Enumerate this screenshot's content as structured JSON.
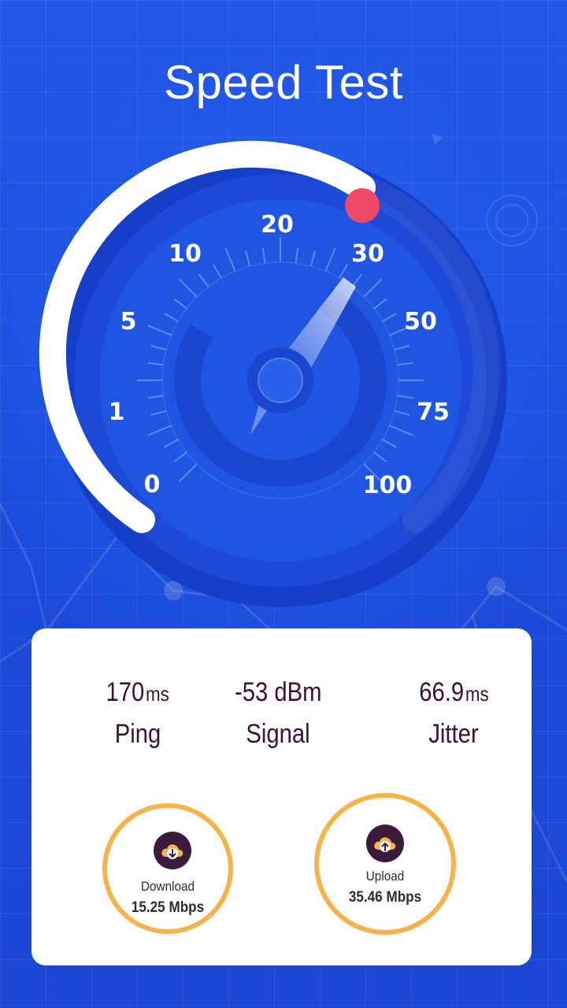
{
  "header": {
    "title": "Speed Test"
  },
  "gauge": {
    "scale_labels": [
      "0",
      "1",
      "5",
      "10",
      "20",
      "30",
      "50",
      "75",
      "100"
    ],
    "current_scale_position": "30"
  },
  "stats": {
    "ping": {
      "value": "170",
      "unit": "ms",
      "label": "Ping"
    },
    "signal": {
      "value": "-53 dBm",
      "label": "Signal"
    },
    "jitter": {
      "value": "66.9",
      "unit": "ms",
      "label": "Jitter"
    }
  },
  "results": {
    "download": {
      "label": "Download",
      "value": "15.25 Mbps",
      "icon": "cloud-download-icon"
    },
    "upload": {
      "label": "Upload",
      "value": "35.46 Mbps",
      "icon": "cloud-upload-icon"
    }
  },
  "colors": {
    "background": "#1f4fe0",
    "accent_ring": "#f7b24a",
    "needle_dot": "#f04a6a",
    "text_dark": "#3a1238"
  }
}
